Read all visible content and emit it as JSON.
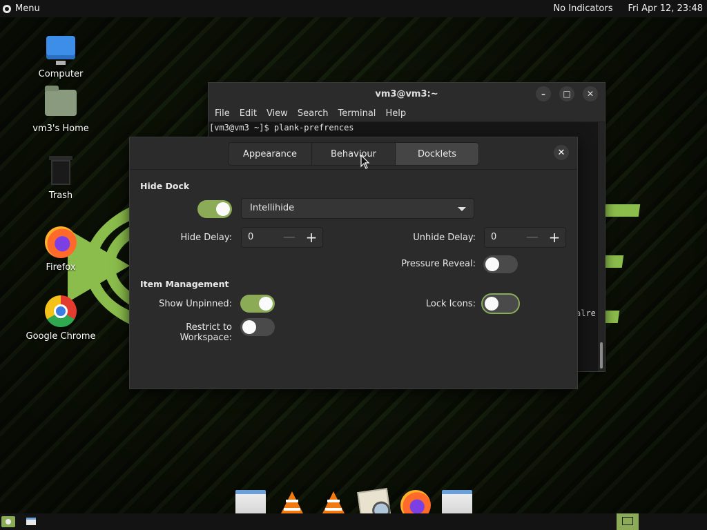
{
  "top_panel": {
    "menu_label": "Menu",
    "indicators": "No Indicators",
    "clock": "Fri Apr 12, 23:48"
  },
  "desktop_icons": [
    {
      "label": "Computer",
      "icon": "computer-icon"
    },
    {
      "label": "vm3's Home",
      "icon": "home-folder-icon"
    },
    {
      "label": "Trash",
      "icon": "trash-icon"
    },
    {
      "label": "Firefox",
      "icon": "firefox-icon"
    },
    {
      "label": "Google Chrome",
      "icon": "chrome-icon"
    }
  ],
  "terminal": {
    "title": "vm3@vm3:~",
    "menu": [
      "File",
      "Edit",
      "View",
      "Search",
      "Terminal",
      "Help"
    ],
    "lines": [
      "[vm3@vm3 ~]$ plank-prefrences"
    ],
    "partial_text": "alre",
    "buttons": {
      "minimize": "–",
      "maximize": "□",
      "close": "✕"
    }
  },
  "dialog": {
    "tabs": [
      "Appearance",
      "Behaviour",
      "Docklets"
    ],
    "active_tab": "Docklets",
    "close": "✕",
    "hide_dock": {
      "title": "Hide Dock",
      "enabled": true,
      "mode": "Intellihide",
      "hide_delay_label": "Hide Delay:",
      "hide_delay_value": "0",
      "unhide_delay_label": "Unhide Delay:",
      "unhide_delay_value": "0",
      "pressure_reveal_label": "Pressure Reveal:",
      "pressure_reveal": false
    },
    "item_management": {
      "title": "Item Management",
      "show_unpinned_label": "Show Unpinned:",
      "show_unpinned": true,
      "lock_icons_label": "Lock Icons:",
      "lock_icons": false,
      "restrict_label": "Restrict to Workspace:",
      "restrict": false
    },
    "spin_minus": "—",
    "spin_plus": "+"
  },
  "dock_items": [
    "window-icon",
    "vlc-icon",
    "vlc-icon",
    "image-viewer-icon",
    "firefox-icon",
    "window-icon"
  ],
  "colors": {
    "accent": "#8bab57",
    "panel": "#131313",
    "dialog_bg": "#2b2b2b"
  }
}
